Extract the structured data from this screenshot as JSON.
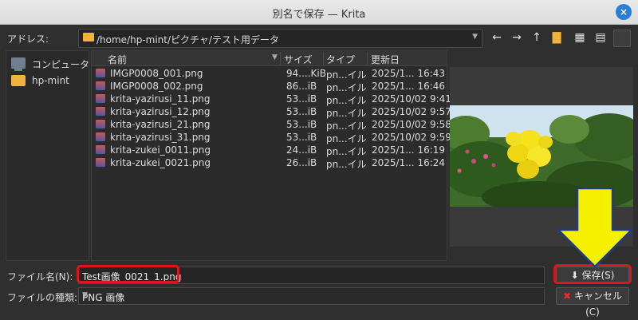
{
  "window": {
    "title": "別名で保存 — Krita",
    "close_glyph": "×"
  },
  "address": {
    "label": "アドレス:",
    "path": "/home/hp-mint/ピクチャ/テスト用データ"
  },
  "toolbar": {
    "back": "←",
    "forward": "→",
    "up": "↑",
    "new_folder": "▇",
    "icon_view": "▦",
    "detail_view": "▤",
    "extra": ""
  },
  "sidebar": {
    "items": [
      {
        "label": "コンピュータ",
        "icon": "computer-icon"
      },
      {
        "label": "hp-mint",
        "icon": "folder-icon"
      }
    ]
  },
  "files": {
    "headers": {
      "name": "名前",
      "size": "サイズ",
      "type": "タイプ",
      "modified": "更新日"
    },
    "rows": [
      {
        "name": "IMGP0008_001.png",
        "size": "94....KiB",
        "type": "pn...イル",
        "modified": "2025/1...  16:43"
      },
      {
        "name": "IMGP0008_002.png",
        "size": "86...iB",
        "type": "pn...イル",
        "modified": "2025/1...  16:46"
      },
      {
        "name": "krita-yazirusi_11.png",
        "size": "53...iB",
        "type": "pn...イル",
        "modified": "2025/10/02 9:41"
      },
      {
        "name": "krita-yazirusi_12.png",
        "size": "53...iB",
        "type": "pn...イル",
        "modified": "2025/10/02 9:57"
      },
      {
        "name": "krita-yazirusi_21.png",
        "size": "53...iB",
        "type": "pn...イル",
        "modified": "2025/10/02 9:58"
      },
      {
        "name": "krita-yazirusi_31.png",
        "size": "53...iB",
        "type": "pn...イル",
        "modified": "2025/10/02 9:59"
      },
      {
        "name": "krita-zukei_0011.png",
        "size": "24...iB",
        "type": "pn...イル",
        "modified": "2025/1...  16:19"
      },
      {
        "name": "krita-zukei_0021.png",
        "size": "26...iB",
        "type": "pn...イル",
        "modified": "2025/1...  16:24"
      }
    ]
  },
  "filename": {
    "label": "ファイル名(N):",
    "value": "Test画像_0021_1.png"
  },
  "filetype": {
    "label": "ファイルの種類:",
    "value": "PNG 画像"
  },
  "buttons": {
    "save": "保存(S)",
    "save_icon": "⬇",
    "cancel": "キャンセル(C)",
    "cancel_icon": "✖"
  },
  "colors": {
    "highlight": "#e0141b",
    "arrow": "#f5f000",
    "folder": "#f2b33d"
  }
}
